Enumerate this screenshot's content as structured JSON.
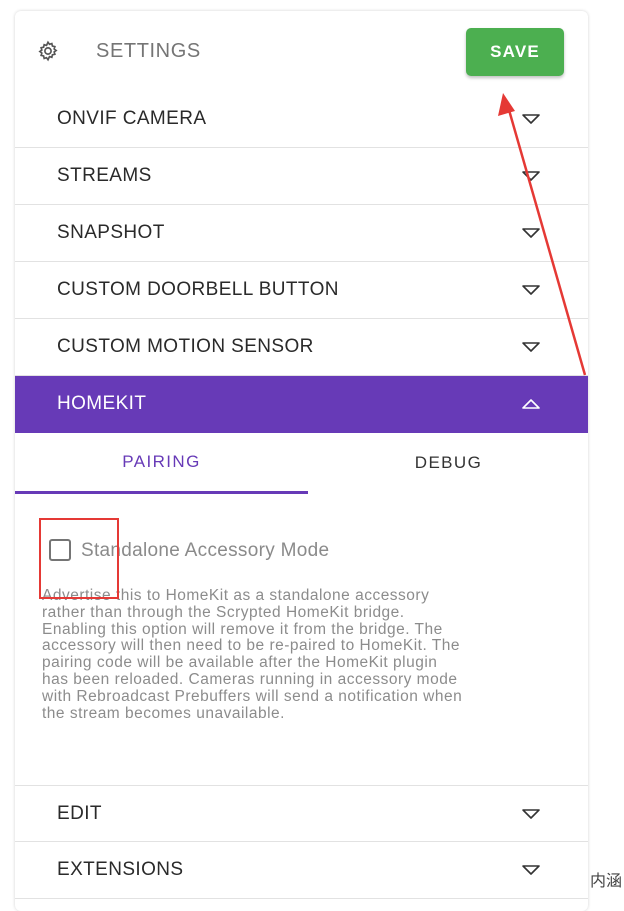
{
  "header": {
    "title": "SETTINGS",
    "save_label": "SAVE",
    "gear_icon": "gear-icon"
  },
  "sections": [
    {
      "label": "ONVIF CAMERA",
      "expanded": false
    },
    {
      "label": "STREAMS",
      "expanded": false
    },
    {
      "label": "SNAPSHOT",
      "expanded": false
    },
    {
      "label": "CUSTOM DOORBELL BUTTON",
      "expanded": false
    },
    {
      "label": "CUSTOM MOTION SENSOR",
      "expanded": false
    },
    {
      "label": "HOMEKIT",
      "expanded": true
    }
  ],
  "homekit": {
    "tabs": [
      {
        "label": "PAIRING",
        "active": true
      },
      {
        "label": "DEBUG",
        "active": false
      }
    ],
    "standalone": {
      "label": "Standalone Accessory Mode",
      "checked": false,
      "description_lines": [
        "Advertise this to HomeKit as a standalone accessory",
        "rather than through the Scrypted HomeKit bridge.",
        "Enabling this option will remove it from the bridge. The",
        "accessory will then need to be re-paired to HomeKit. The",
        "pairing code will be available after the HomeKit plugin",
        "has been reloaded. Cameras running in accessory mode",
        "with Rebroadcast Prebuffers will send a notification when",
        "the stream becomes unavailable."
      ]
    }
  },
  "lower_sections": [
    {
      "label": "EDIT",
      "expanded": false
    },
    {
      "label": "EXTENSIONS",
      "expanded": false
    }
  ],
  "corner_text": "内涵",
  "colors": {
    "accent": "#673ab7",
    "save": "#4caf50",
    "annotation": "#e53935"
  }
}
